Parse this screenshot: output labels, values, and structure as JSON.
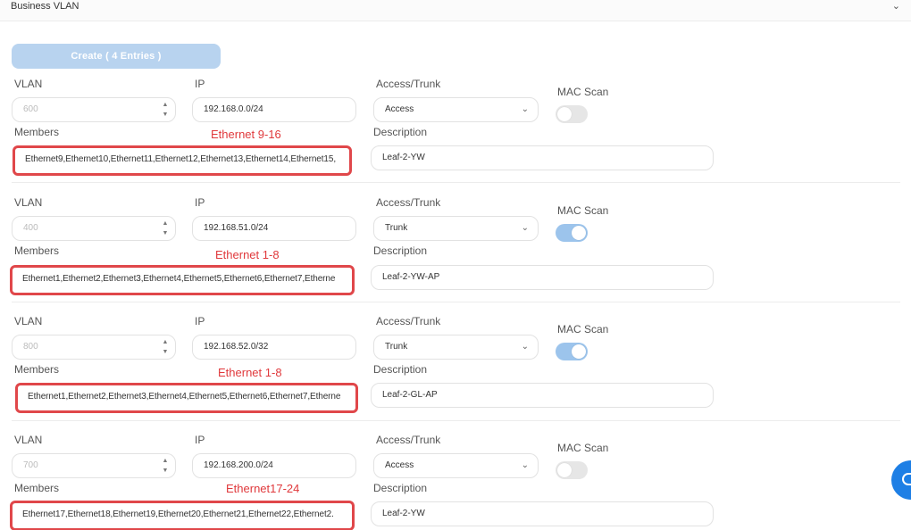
{
  "header": {
    "title": "Business VLAN",
    "chevron": "⌄"
  },
  "create_button": "Create ( 4 Entries )",
  "labels": {
    "vlan": "VLAN",
    "ip": "IP",
    "access_trunk": "Access/Trunk",
    "mac_scan": "MAC Scan",
    "members": "Members",
    "description": "Description"
  },
  "entries": [
    {
      "vlan": "600",
      "ip": "192.168.0.0/24",
      "mode": "Access",
      "mac_scan": false,
      "members": "Ethernet9,Ethernet10,Ethernet11,Ethernet12,Ethernet13,Ethernet14,Ethernet15,",
      "description": "Leaf-2-YW",
      "annotation": "Ethernet 9-16"
    },
    {
      "vlan": "400",
      "ip": "192.168.51.0/24",
      "mode": "Trunk",
      "mac_scan": true,
      "members": "Ethernet1,Ethernet2,Ethernet3,Ethernet4,Ethernet5,Ethernet6,Ethernet7,Etherne",
      "description": "Leaf-2-YW-AP",
      "annotation": "Ethernet 1-8"
    },
    {
      "vlan": "800",
      "ip": "192.168.52.0/32",
      "mode": "Trunk",
      "mac_scan": true,
      "members": "Ethernet1,Ethernet2,Ethernet3,Ethernet4,Ethernet5,Ethernet6,Ethernet7,Etherne",
      "description": "Leaf-2-GL-AP",
      "annotation": "Ethernet 1-8"
    },
    {
      "vlan": "700",
      "ip": "192.168.200.0/24",
      "mode": "Access",
      "mac_scan": false,
      "members": "Ethernet17,Ethernet18,Ethernet19,Ethernet20,Ethernet21,Ethernet22,Ethernet2.",
      "description": "Leaf-2-YW",
      "annotation": "Ethernet17-24"
    }
  ],
  "icons": {
    "spinner_up": "▲",
    "spinner_down": "▼",
    "select_chevron": "⌄",
    "chat": "chat-icon"
  },
  "colors": {
    "accent": "#9cc4ec",
    "create_button": "#b8d3ef",
    "annotation": "#e0393c",
    "chat_button": "#1e7fe5"
  }
}
